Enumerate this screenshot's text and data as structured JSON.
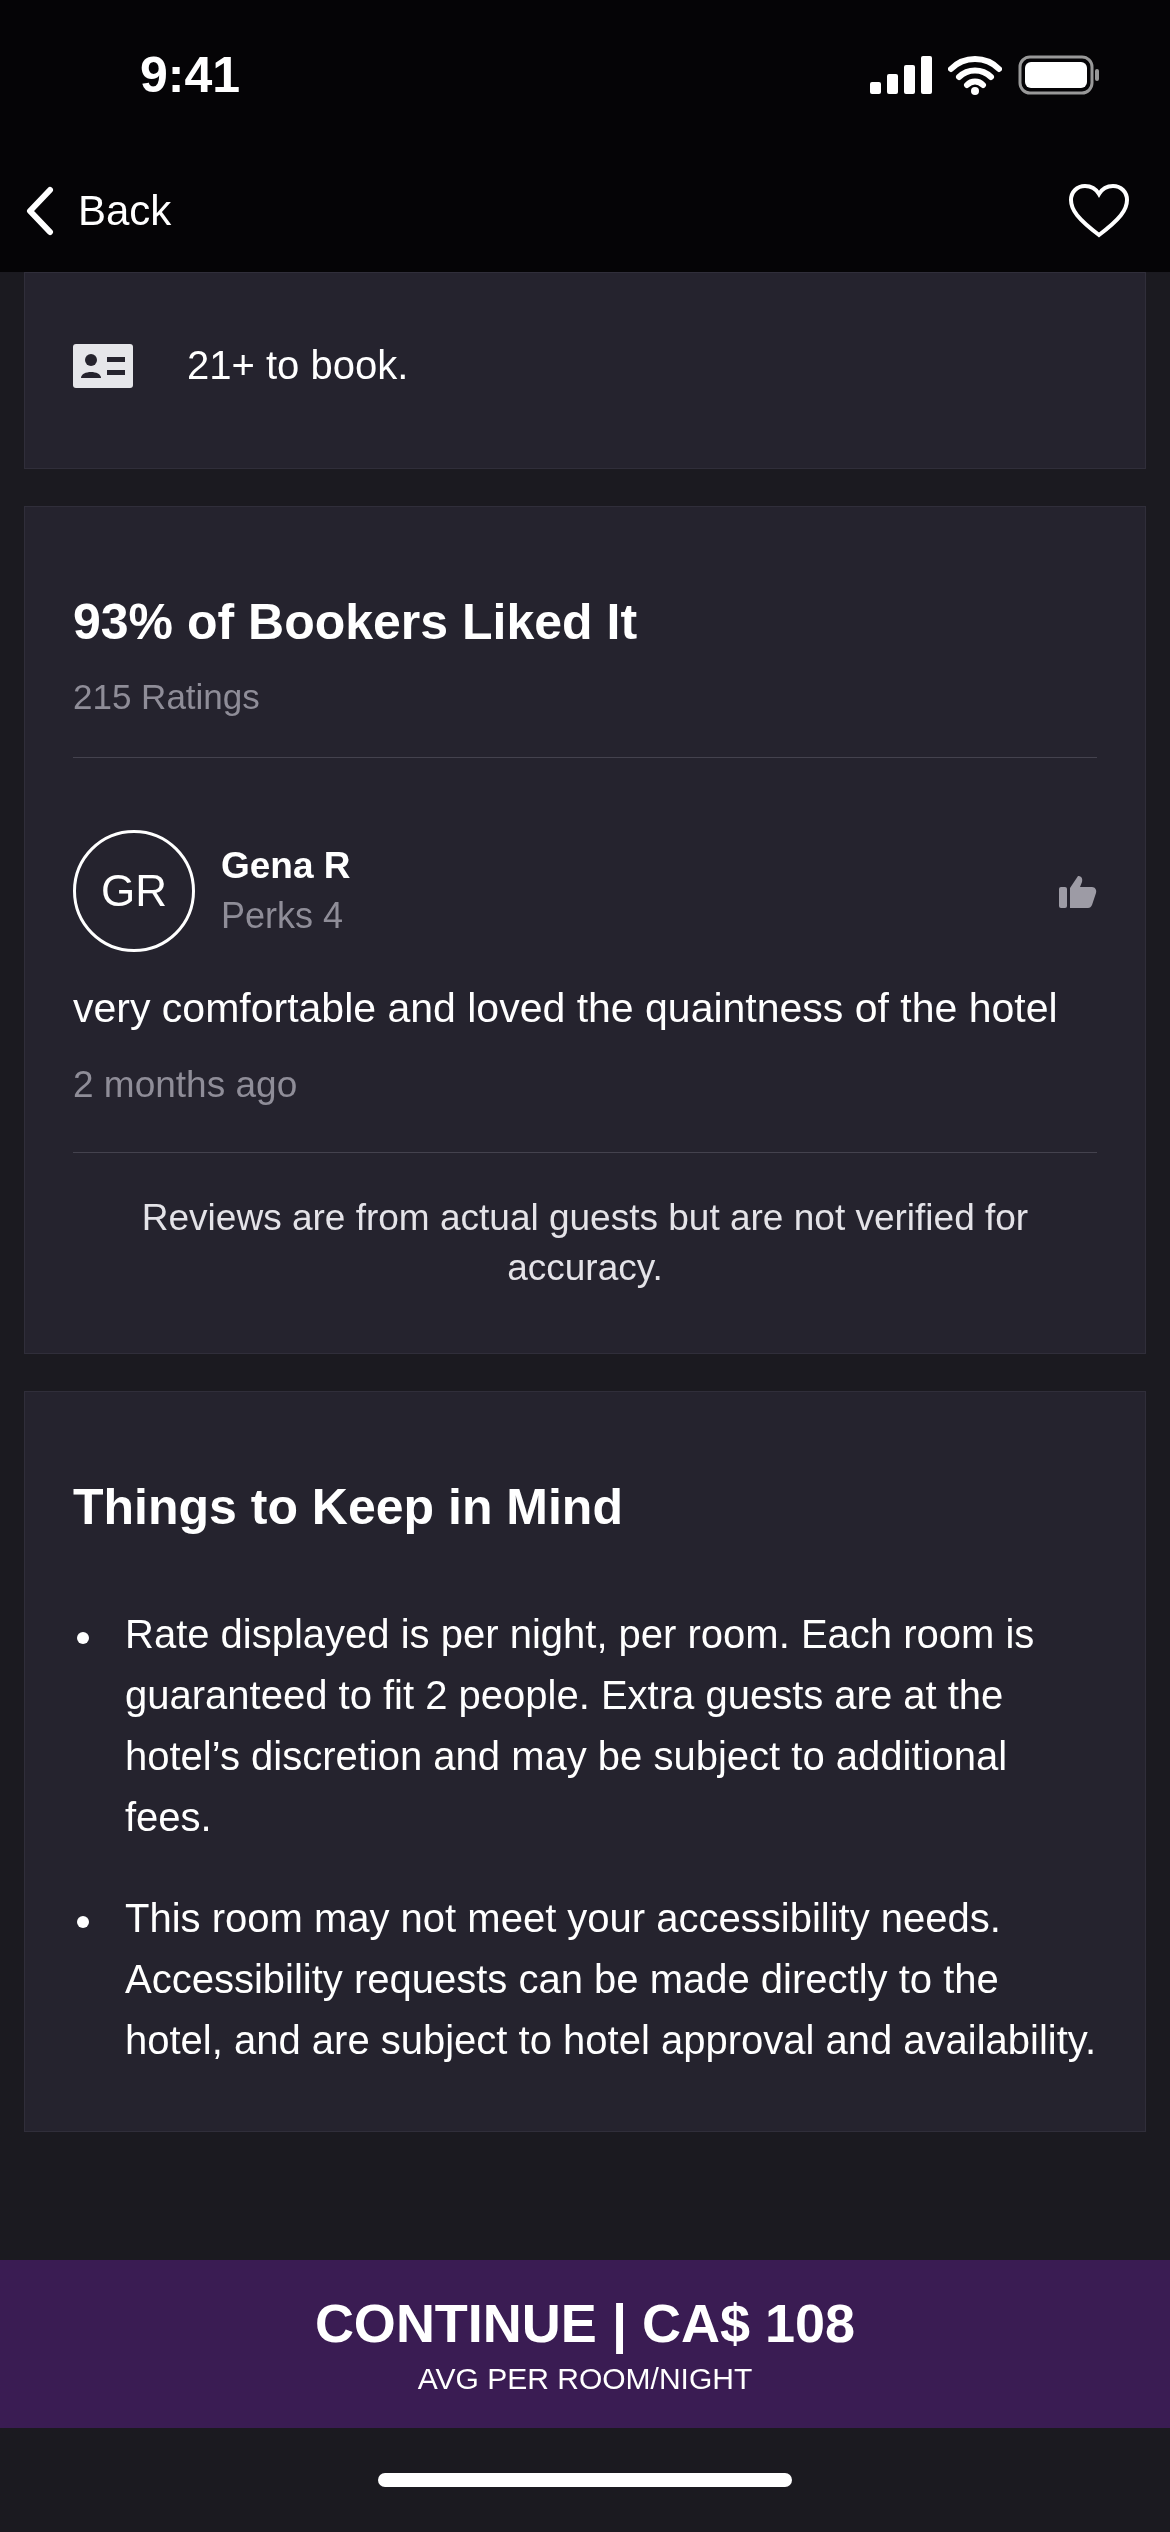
{
  "status_bar": {
    "time": "9:41"
  },
  "nav": {
    "back_label": "Back",
    "favorite": false
  },
  "policy": {
    "text": "21+ to book."
  },
  "reviews": {
    "title": "93% of Bookers Liked It",
    "count": "215 Ratings",
    "items": [
      {
        "initials": "GR",
        "name": "Gena R",
        "tier": "Perks 4",
        "text": "very comfortable and loved the quaintness of the hotel",
        "age": "2 months ago"
      }
    ],
    "disclaimer": "Reviews are from actual guests but are not verified for accuracy."
  },
  "notes": {
    "title": "Things to Keep in Mind",
    "items": [
      "Rate displayed is per night, per room. Each room is guaranteed to fit 2 people. Extra guests are at the hotel’s discretion and may be subject to additional fees.",
      "This room may not meet your accessibility needs. Accessibility requests can be made directly to the hotel, and are subject to hotel approval and availability."
    ]
  },
  "footer": {
    "button": "CONTINUE | CA$ 108",
    "caption": "AVG PER ROOM/NIGHT"
  }
}
